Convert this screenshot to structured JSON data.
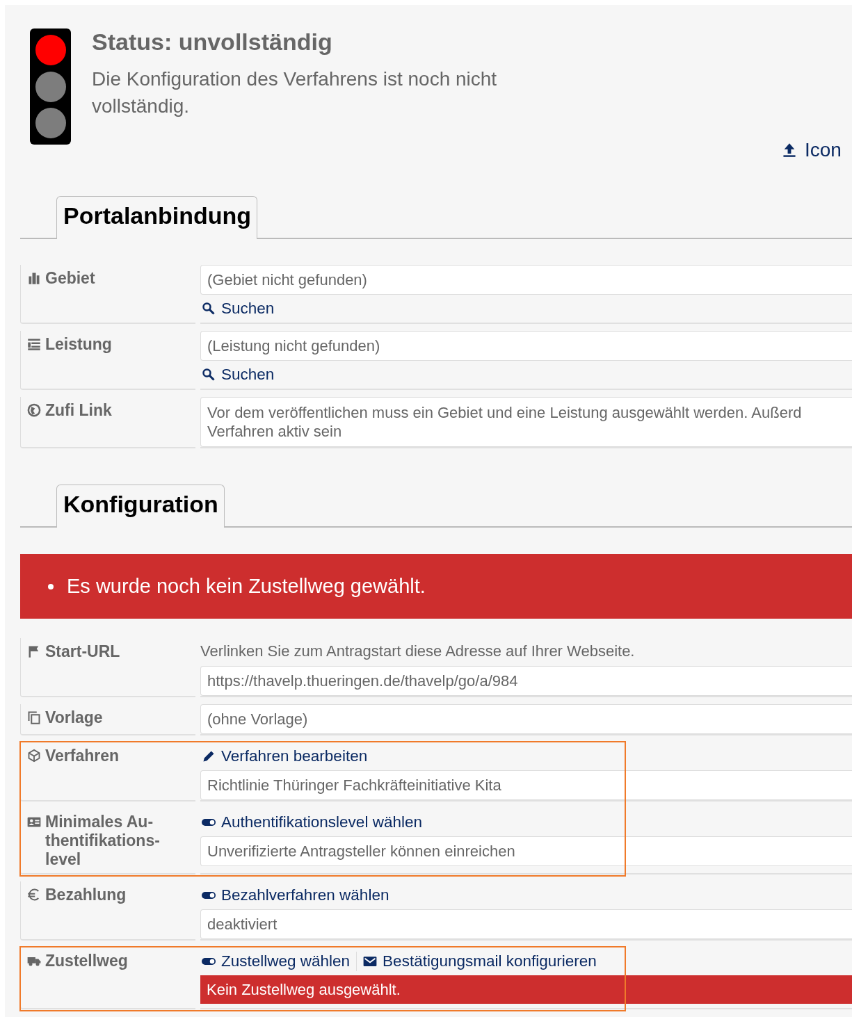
{
  "status": {
    "lights": [
      {
        "on": true
      },
      {
        "on": false
      },
      {
        "on": false
      }
    ],
    "title": "Status: unvollständig",
    "description": "Die Konfiguration des Verfahrens ist noch nicht vollständig."
  },
  "upload_link": {
    "label": "Icon"
  },
  "sections": [
    {
      "tab": "Portalanbindung",
      "rows": [
        {
          "label": "Gebiet",
          "highlighted": false,
          "parts": [
            {
              "kind": "field",
              "value": "(Gebiet nicht gefunden)"
            },
            {
              "kind": "links",
              "links": [
                {
                  "kind": "search",
                  "label": "Suchen"
                }
              ]
            }
          ]
        },
        {
          "label": "Leistung",
          "highlighted": false,
          "parts": [
            {
              "kind": "field",
              "value": "(Leistung nicht gefunden)"
            },
            {
              "kind": "links",
              "links": [
                {
                  "kind": "search",
                  "label": "Suchen"
                }
              ]
            }
          ]
        },
        {
          "label": "Zufi Link",
          "highlighted": false,
          "parts": [
            {
              "kind": "note",
              "lines": [
                "Vor dem veröffentlichen muss ein Gebiet und eine Leistung ausgewählt werden. Außerd",
                "Verfahren aktiv sein"
              ]
            }
          ]
        }
      ]
    },
    {
      "tab": "Konfiguration",
      "errors": [
        "Es wurde noch kein Zustellweg gewählt."
      ],
      "rows": [
        {
          "label": "Start-URL",
          "highlighted": false,
          "parts": [
            {
              "kind": "hint",
              "text": "Verlinken Sie zum Antragstart diese Adresse auf Ihrer Webseite."
            },
            {
              "kind": "field",
              "value": "https://thavelp.thueringen.de/thavelp/go/a/984"
            }
          ]
        },
        {
          "label": "Vorlage",
          "highlighted": false,
          "parts": [
            {
              "kind": "field",
              "value": "(ohne Vorlage)"
            }
          ]
        },
        {
          "label": "Verfahren",
          "highlighted": true,
          "parts": [
            {
              "kind": "links",
              "links": [
                {
                  "kind": "edit",
                  "label": "Verfahren bearbeiten"
                }
              ]
            },
            {
              "kind": "field",
              "value": "Richtlinie Thüringer Fachkräfteinitiative Kita"
            }
          ]
        },
        {
          "label": "Minimales Au-thentifikations-level",
          "highlighted": true,
          "parts": [
            {
              "kind": "links",
              "links": [
                {
                  "kind": "toggle",
                  "label": "Authentifikationslevel wählen"
                }
              ]
            },
            {
              "kind": "field",
              "value": "Unverifizierte Antragsteller können einreichen"
            }
          ]
        },
        {
          "label": "Bezahlung",
          "highlighted": false,
          "parts": [
            {
              "kind": "links",
              "links": [
                {
                  "kind": "toggle",
                  "label": "Bezahlverfahren wählen"
                }
              ]
            },
            {
              "kind": "field",
              "value": "deaktiviert"
            }
          ]
        },
        {
          "label": "Zustellweg",
          "highlighted": true,
          "parts": [
            {
              "kind": "links",
              "links": [
                {
                  "kind": "toggle",
                  "label": "Zustellweg wählen"
                },
                {
                  "kind": "mail",
                  "label": "Bestätigungsmail konfigurieren"
                }
              ]
            },
            {
              "kind": "error",
              "text": "Kein Zustellweg ausgewählt."
            }
          ]
        }
      ]
    }
  ]
}
